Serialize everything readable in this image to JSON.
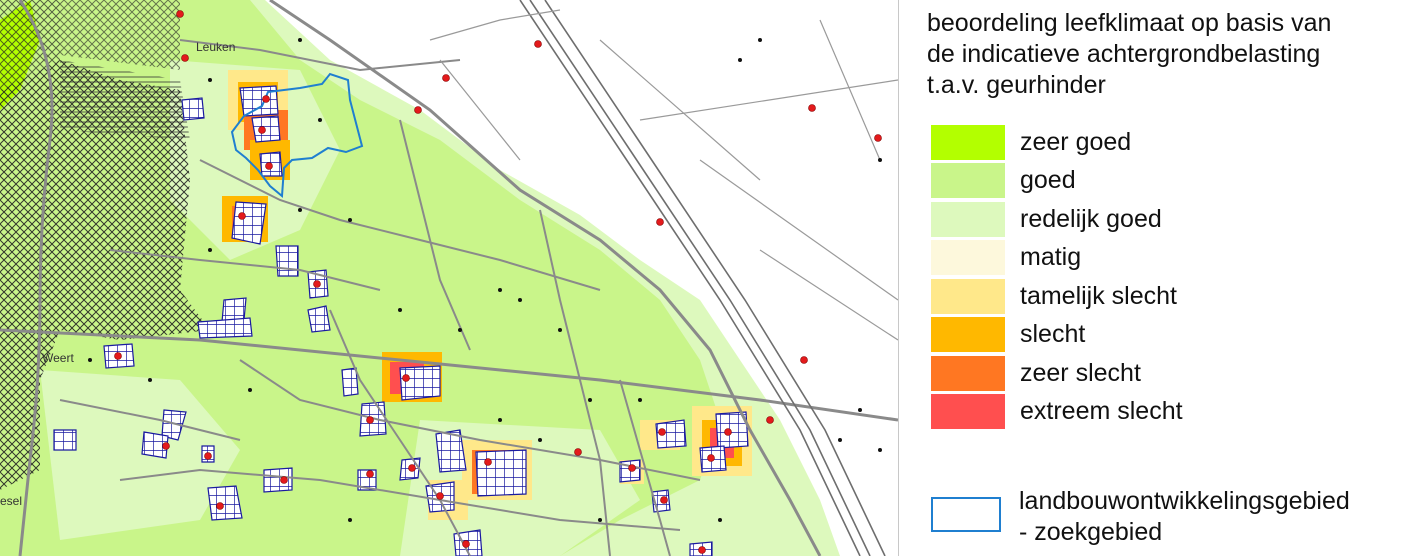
{
  "map": {
    "place_labels": [
      {
        "name": "Leuken"
      },
      {
        "name": "Weert"
      },
      {
        "name": "esel"
      }
    ]
  },
  "legend": {
    "title_lines": [
      "beoordeling leefklimaat op basis van",
      "de indicatieve achtergrondbelasting",
      "t.a.v. geurhinder"
    ],
    "classes": [
      {
        "label": "zeer goed",
        "color": "#b3ff00"
      },
      {
        "label": "goed",
        "color": "#c9f58a"
      },
      {
        "label": "redelijk goed",
        "color": "#ddf9bd"
      },
      {
        "label": "matig",
        "color": "#fdf8dc"
      },
      {
        "label": "tamelijk slecht",
        "color": "#ffe88a"
      },
      {
        "label": "slecht",
        "color": "#ffb800"
      },
      {
        "label": "zeer slecht",
        "color": "#ff7722"
      },
      {
        "label": "extreem slecht",
        "color": "#ff4f4f"
      }
    ],
    "zone": {
      "label_lines": [
        "landbouwontwikkelingsgebied",
        "- zoekgebied"
      ],
      "color": "#1f7fd0"
    }
  }
}
